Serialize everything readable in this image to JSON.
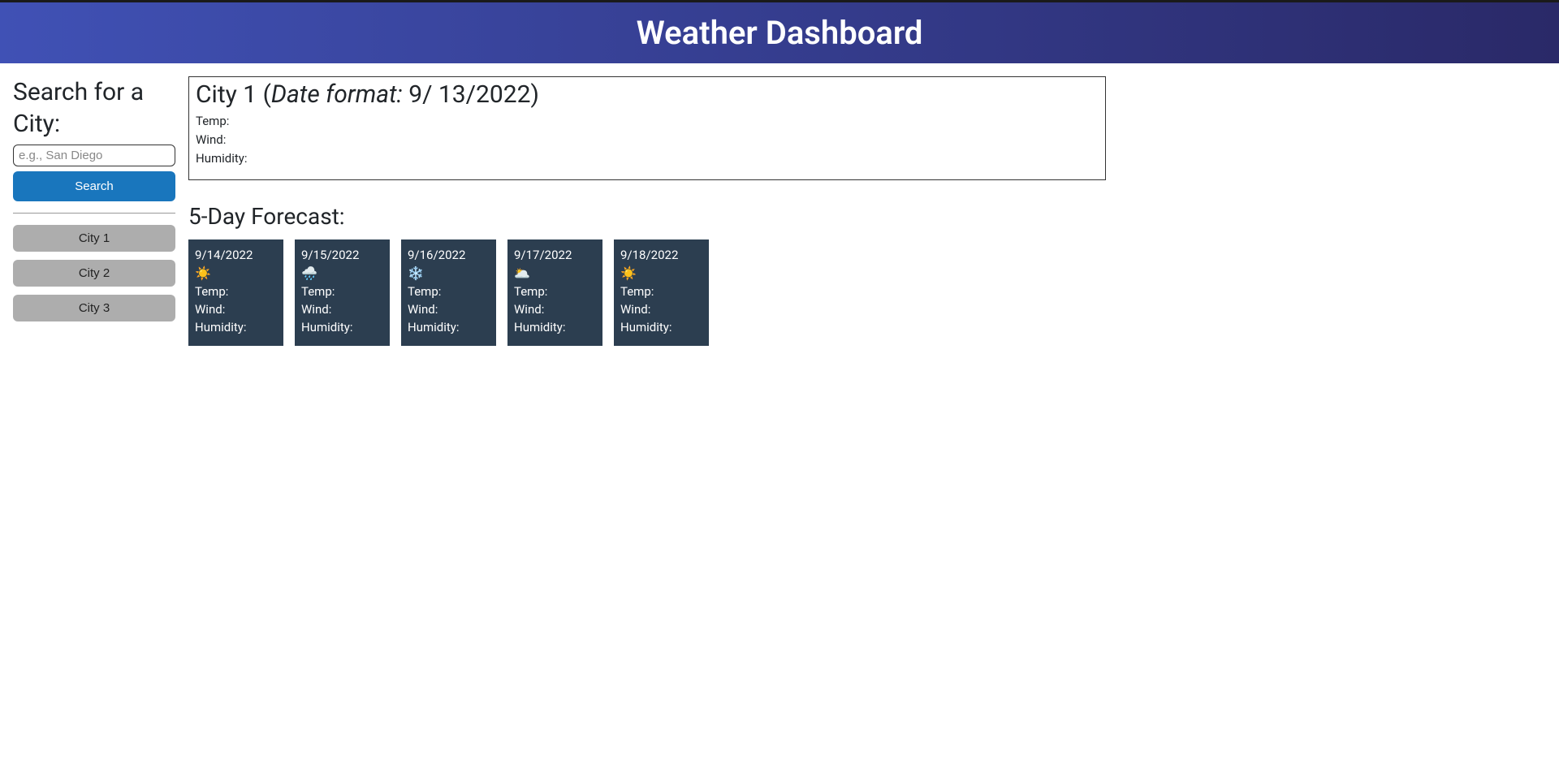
{
  "header": {
    "title": "Weather Dashboard"
  },
  "search": {
    "heading": "Search for a City:",
    "placeholder": "e.g., San Diego",
    "button_label": "Search"
  },
  "history": [
    {
      "label": "City 1"
    },
    {
      "label": "City 2"
    },
    {
      "label": "City 3"
    }
  ],
  "current": {
    "city": "City 1",
    "date_format_label": "Date format:",
    "date": "9/ 13/2022",
    "temp_label": "Temp:",
    "wind_label": "Wind:",
    "humidity_label": "Humidity:"
  },
  "forecast": {
    "title": "5-Day Forecast:",
    "days": [
      {
        "date": "9/14/2022",
        "icon": "☀️",
        "temp_label": "Temp:",
        "wind_label": "Wind:",
        "humidity_label": "Humidity:"
      },
      {
        "date": "9/15/2022",
        "icon": "🌧️",
        "temp_label": "Temp:",
        "wind_label": "Wind:",
        "humidity_label": "Humidity:"
      },
      {
        "date": "9/16/2022",
        "icon": "❄️",
        "temp_label": "Temp:",
        "wind_label": "Wind:",
        "humidity_label": "Humidity:"
      },
      {
        "date": "9/17/2022",
        "icon": "🌥️",
        "temp_label": "Temp:",
        "wind_label": "Wind:",
        "humidity_label": "Humidity:"
      },
      {
        "date": "9/18/2022",
        "icon": "☀️",
        "temp_label": "Temp:",
        "wind_label": "Wind:",
        "humidity_label": "Humidity:"
      }
    ]
  }
}
